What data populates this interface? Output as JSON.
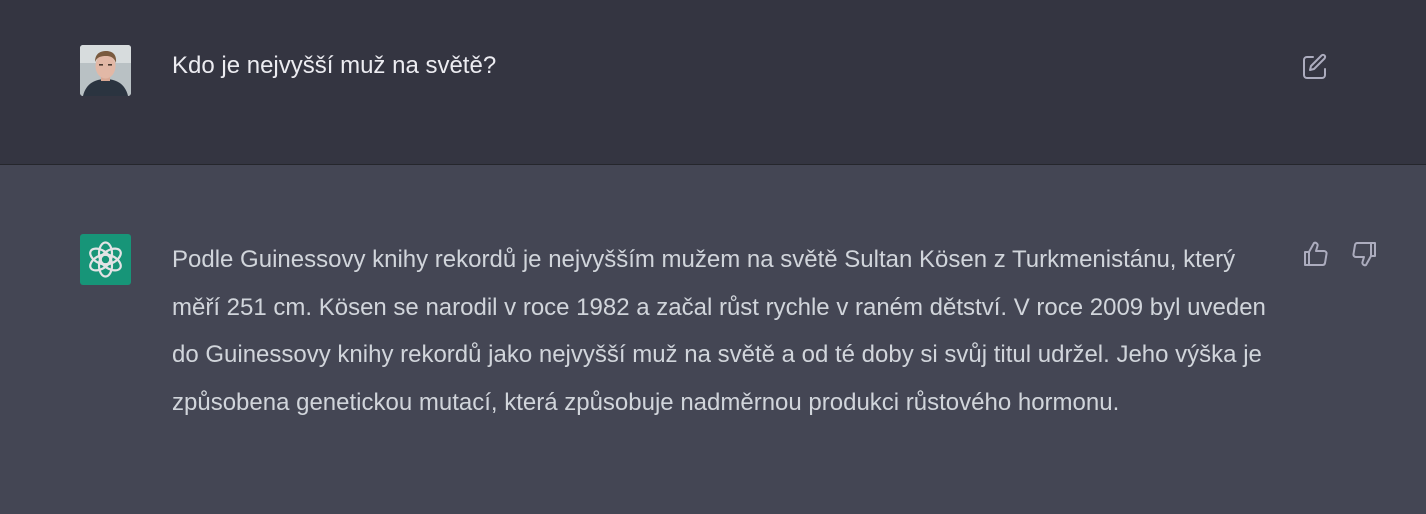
{
  "user_message": {
    "text": "Kdo je nejvyšší muž na světě?",
    "avatar": "user-avatar-photo",
    "edit_icon": "edit-icon"
  },
  "assistant_message": {
    "text": "Podle Guinessovy knihy rekordů je nejvyšším mužem na světě Sultan Kösen z Turkmenistánu, který měří 251 cm. Kösen se narodil v roce 1982 a začal růst rychle v raném dětství. V roce 2009 byl uveden do Guinessovy knihy rekordů jako nejvyšší muž na světě a od té doby si svůj titul udržel. Jeho výška je způsobena genetickou mutací, která způsobuje nadměrnou produkci růstového hormonu.",
    "avatar": "chatgpt-logo-icon",
    "feedback_icons": [
      "thumbs-up-icon",
      "thumbs-down-icon"
    ]
  },
  "colors": {
    "user_row_bg": "#343541",
    "assistant_row_bg": "#444654",
    "accent": "#10a37f",
    "text_primary": "#ececf1",
    "text_secondary": "#d1d5db",
    "icon": "#acacbe"
  }
}
